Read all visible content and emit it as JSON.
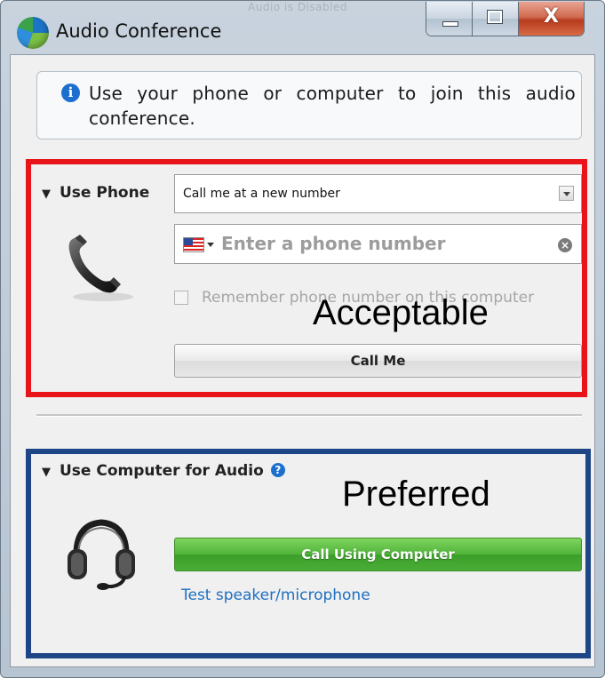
{
  "window": {
    "title": "Audio Conference",
    "title_ghost": "Audio is Disabled",
    "controls": {
      "minimize": "—",
      "maximize": "☐",
      "close": "X"
    }
  },
  "info": {
    "icon": "info-icon",
    "text": "Use your phone or computer to join this audio conference."
  },
  "phone": {
    "label": "Use Phone",
    "select_value": "Call me at a new number",
    "input_placeholder": "Enter a phone number",
    "remember_label": "Remember phone number on this computer",
    "remember_checked": false,
    "call_button": "Call Me",
    "annotation": "Acceptable",
    "annotation_color": "#e8141a"
  },
  "computer": {
    "label": "Use Computer for Audio",
    "help": "?",
    "call_button": "Call Using Computer",
    "test_link": "Test speaker/microphone",
    "annotation": "Preferred",
    "annotation_color": "#1e4585"
  },
  "colors": {
    "accent_green": "#4fb33a",
    "link_blue": "#1f6fc0",
    "info_blue": "#1c6fcf"
  }
}
